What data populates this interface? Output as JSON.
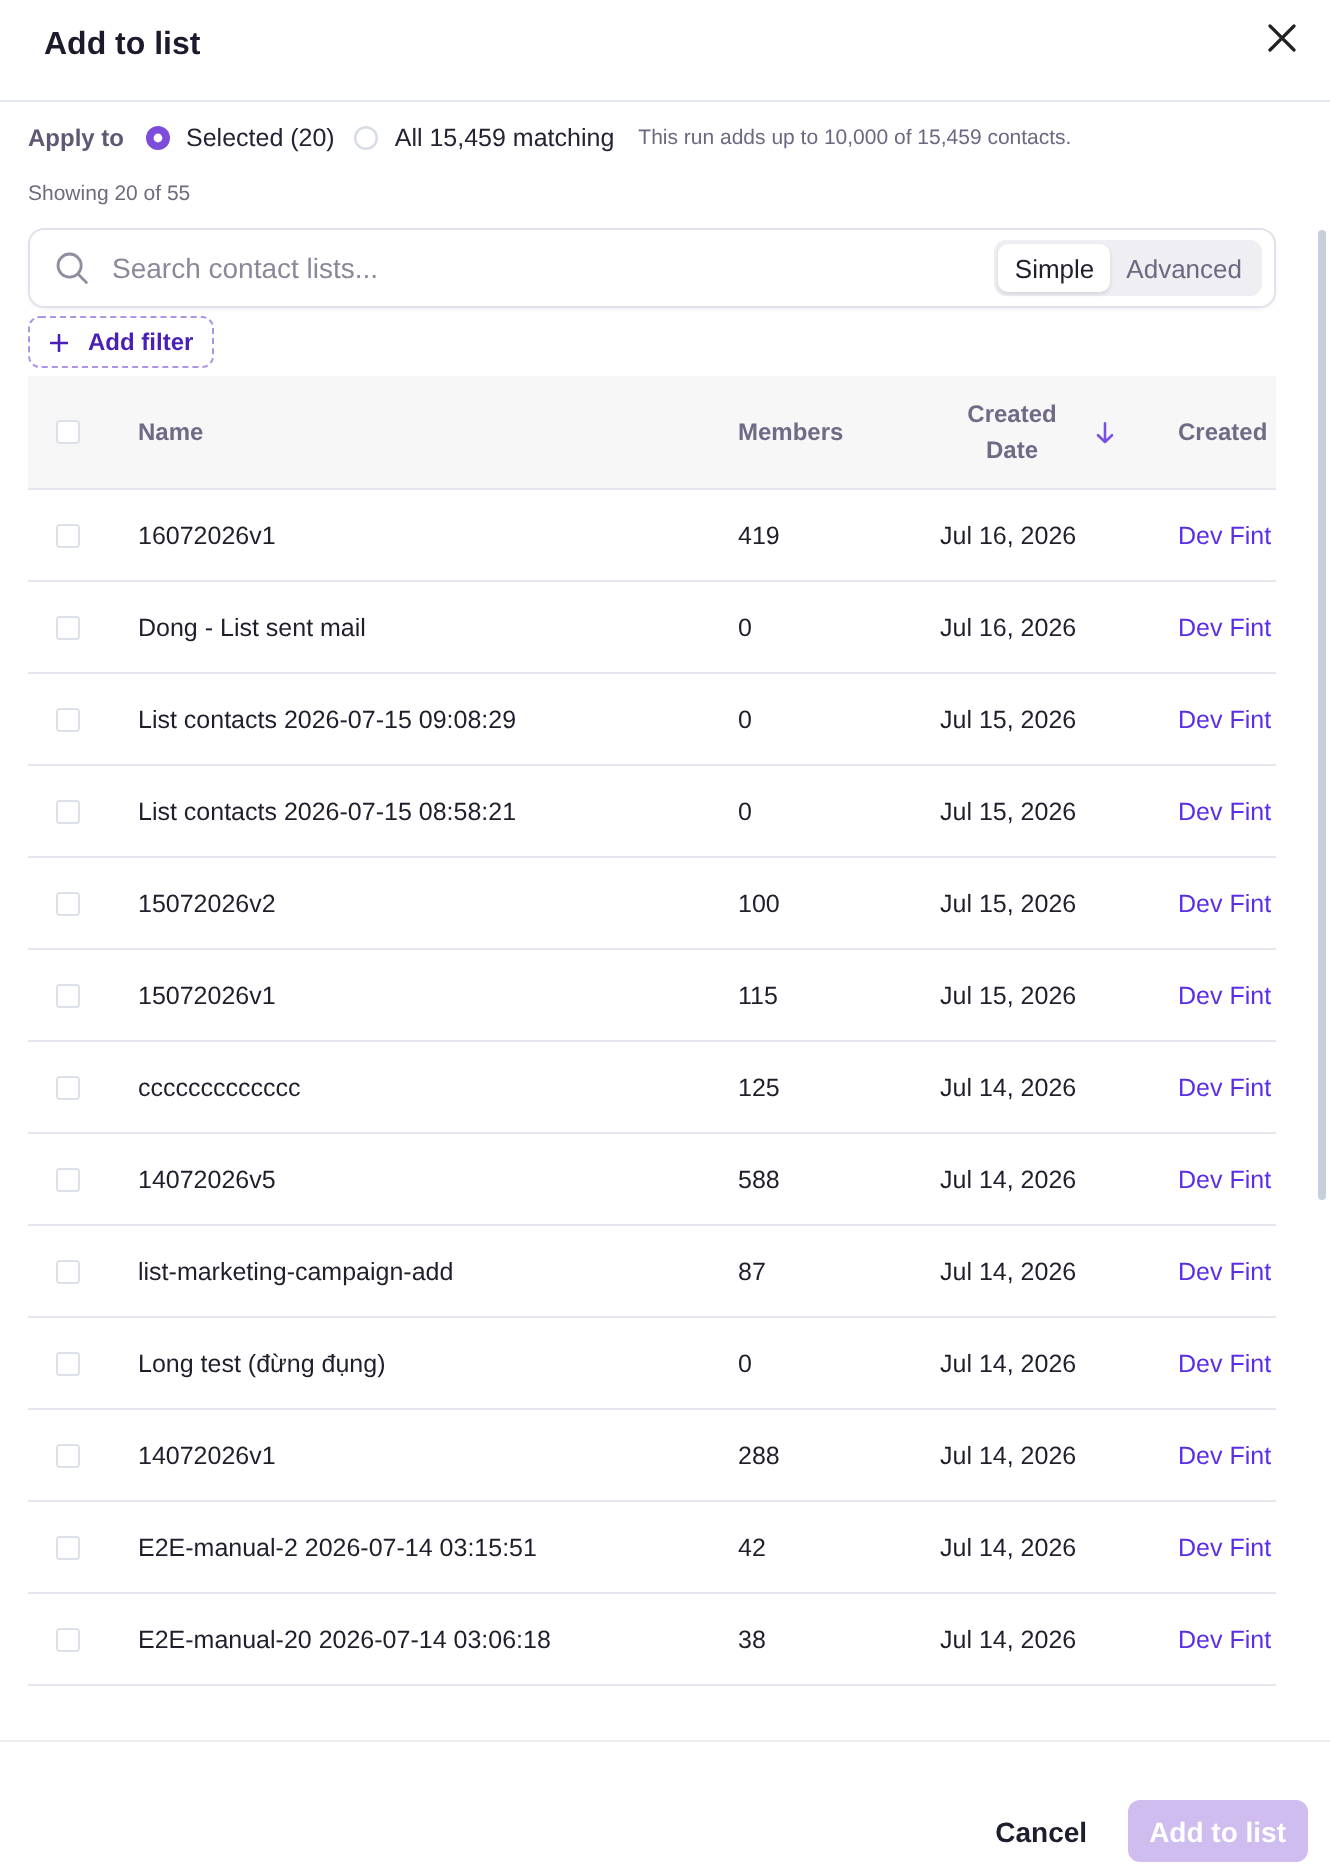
{
  "dialog": {
    "title": "Add to list"
  },
  "apply_to": {
    "label": "Apply to",
    "options": [
      {
        "label": "Selected (20)",
        "selected": true
      },
      {
        "label": "All 15,459 matching",
        "selected": false
      }
    ],
    "note": "This run adds up to 10,000 of 15,459 contacts."
  },
  "result_count": "Showing 20 of 55",
  "search": {
    "placeholder": "Search contact lists...",
    "modes": [
      {
        "label": "Simple",
        "selected": true
      },
      {
        "label": "Advanced",
        "selected": false
      }
    ]
  },
  "add_filter": {
    "label": "Add filter"
  },
  "table": {
    "select_all": {
      "checked": false
    },
    "columns": [
      {
        "label": "Name",
        "sorted": false
      },
      {
        "label": "Members",
        "sorted": false
      },
      {
        "label": "Created Date",
        "sorted": true,
        "descending": true
      },
      {
        "label": "Created",
        "sorted": false
      }
    ],
    "rows": [
      {
        "checked": false,
        "name": "16072026v1",
        "members": "419",
        "created_date": "Jul 16, 2026",
        "column_5": "Dev Fint"
      },
      {
        "checked": false,
        "name": "Dong - List sent mail",
        "members": "0",
        "created_date": "Jul 16, 2026",
        "column_5": "Dev Fint"
      },
      {
        "checked": false,
        "name": "List contacts 2026-07-15 09:08:29",
        "members": "0",
        "created_date": "Jul 15, 2026",
        "column_5": "Dev Fint"
      },
      {
        "checked": false,
        "name": "List contacts 2026-07-15 08:58:21",
        "members": "0",
        "created_date": "Jul 15, 2026",
        "column_5": "Dev Fint"
      },
      {
        "checked": false,
        "name": "15072026v2",
        "members": "100",
        "created_date": "Jul 15, 2026",
        "column_5": "Dev Fint"
      },
      {
        "checked": false,
        "name": "15072026v1",
        "members": "115",
        "created_date": "Jul 15, 2026",
        "column_5": "Dev Fint"
      },
      {
        "checked": false,
        "name": "ccccccccccccc",
        "members": "125",
        "created_date": "Jul 14, 2026",
        "column_5": "Dev Fint"
      },
      {
        "checked": false,
        "name": "14072026v5",
        "members": "588",
        "created_date": "Jul 14, 2026",
        "column_5": "Dev Fint"
      },
      {
        "checked": false,
        "name": "list-marketing-campaign-add",
        "members": "87",
        "created_date": "Jul 14, 2026",
        "column_5": "Dev Fint"
      },
      {
        "checked": false,
        "name": "Long test (đừng đụng)",
        "members": "0",
        "created_date": "Jul 14, 2026",
        "column_5": "Dev Fint"
      },
      {
        "checked": false,
        "name": "14072026v1",
        "members": "288",
        "created_date": "Jul 14, 2026",
        "column_5": "Dev Fint"
      },
      {
        "checked": false,
        "name": "E2E-manual-2 2026-07-14 03:15:51",
        "members": "42",
        "created_date": "Jul 14, 2026",
        "column_5": "Dev Fint"
      },
      {
        "checked": false,
        "name": "E2E-manual-20 2026-07-14 03:06:18",
        "members": "38",
        "created_date": "Jul 14, 2026",
        "column_5": "Dev Fint"
      }
    ]
  },
  "footer": {
    "buttons": [
      {
        "kind": "secondary",
        "label": "Cancel",
        "disabled": false
      },
      {
        "kind": "primary",
        "label": "Add to list",
        "disabled": true
      }
    ]
  }
}
